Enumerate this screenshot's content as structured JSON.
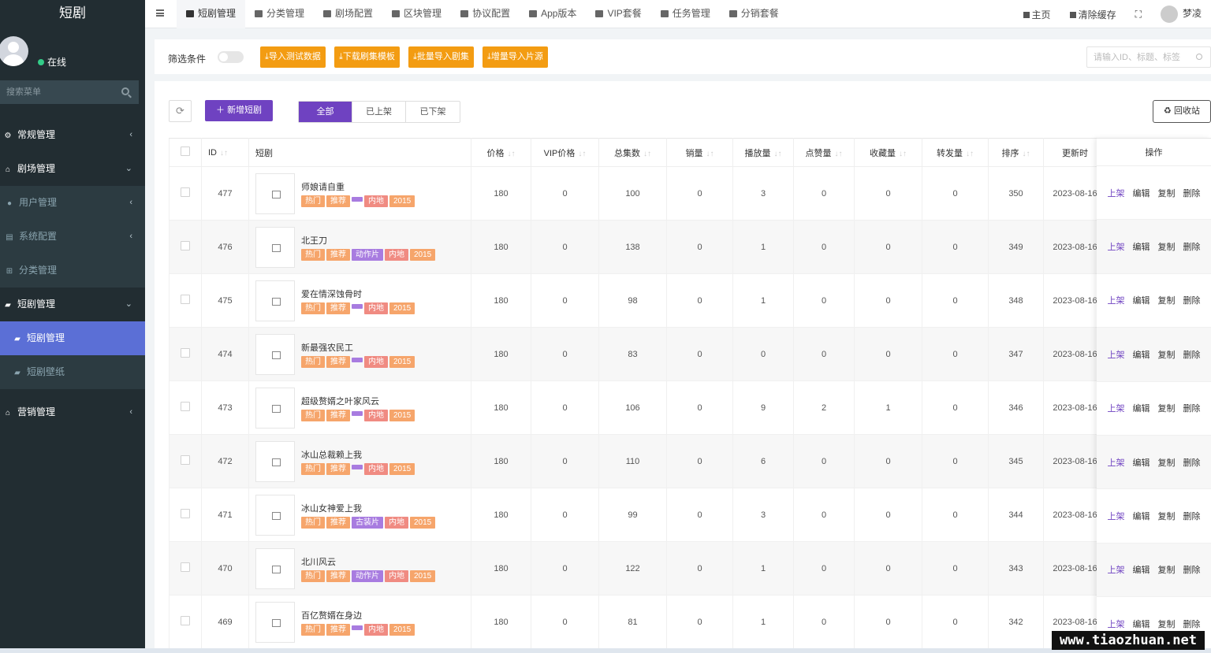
{
  "app": {
    "title": "短剧",
    "user_status": "在线",
    "search_placeholder": "搜索菜单"
  },
  "sidebar": {
    "items": [
      {
        "label": "常规管理",
        "icon": "gears-icon",
        "arrow": "‹"
      },
      {
        "label": "剧场管理",
        "icon": "home-icon",
        "arrow": "⌄"
      },
      {
        "label": "用户管理",
        "icon": "user-icon",
        "arrow": "‹"
      },
      {
        "label": "系统配置",
        "icon": "file-icon",
        "arrow": "‹"
      },
      {
        "label": "分类管理",
        "icon": "sitemap-icon",
        "arrow": ""
      },
      {
        "label": "短剧管理",
        "icon": "bag-icon",
        "arrow": "⌄"
      },
      {
        "label": "短剧管理",
        "icon": "bag-icon",
        "arrow": ""
      },
      {
        "label": "短剧壁纸",
        "icon": "bag-icon",
        "arrow": ""
      },
      {
        "label": "营销管理",
        "icon": "home-icon",
        "arrow": "‹"
      }
    ]
  },
  "topbar": {
    "tabs": [
      "短剧管理",
      "分类管理",
      "剧场配置",
      "区块管理",
      "协议配置",
      "App版本",
      "VIP套餐",
      "任务管理",
      "分销套餐"
    ],
    "home": "主页",
    "clear_cache": "清除缓存",
    "username": "梦凌"
  },
  "filter": {
    "label": "筛选条件",
    "buttons": [
      "⤓导入测试数据",
      "⤓下载刷集模板",
      "⤓批量导入剧集",
      "⤓增量导入片源"
    ],
    "search_placeholder": "请输入ID、标题、标签"
  },
  "toolbar": {
    "add_label": "新增短剧",
    "segments": [
      "全部",
      "已上架",
      "已下架"
    ],
    "recycle_label": "回收站"
  },
  "table": {
    "headers": [
      "ID",
      "短剧",
      "价格",
      "VIP价格",
      "总集数",
      "销量",
      "播放量",
      "点赞量",
      "收藏量",
      "转发量",
      "排序",
      "更新时",
      "操作"
    ],
    "actions": [
      "上架",
      "编辑",
      "复制",
      "删除"
    ],
    "rows": [
      {
        "id": "477",
        "title": "师娘请自重",
        "tags": [
          "热门",
          "推荐",
          "",
          "内地",
          "2015"
        ],
        "price": "180",
        "vip": "0",
        "episodes": "100",
        "sales": "0",
        "plays": "3",
        "likes": "0",
        "favs": "0",
        "shares": "0",
        "sort": "350",
        "updated": "2023-08-16"
      },
      {
        "id": "476",
        "title": "北王刀",
        "tags": [
          "热门",
          "推荐",
          "动作片",
          "内地",
          "2015"
        ],
        "price": "180",
        "vip": "0",
        "episodes": "138",
        "sales": "0",
        "plays": "1",
        "likes": "0",
        "favs": "0",
        "shares": "0",
        "sort": "349",
        "updated": "2023-08-16"
      },
      {
        "id": "475",
        "title": "爱在情深蚀骨时",
        "tags": [
          "热门",
          "推荐",
          "",
          "内地",
          "2015"
        ],
        "price": "180",
        "vip": "0",
        "episodes": "98",
        "sales": "0",
        "plays": "1",
        "likes": "0",
        "favs": "0",
        "shares": "0",
        "sort": "348",
        "updated": "2023-08-16"
      },
      {
        "id": "474",
        "title": "新最强农民工",
        "tags": [
          "热门",
          "推荐",
          "",
          "内地",
          "2015"
        ],
        "price": "180",
        "vip": "0",
        "episodes": "83",
        "sales": "0",
        "plays": "0",
        "likes": "0",
        "favs": "0",
        "shares": "0",
        "sort": "347",
        "updated": "2023-08-16"
      },
      {
        "id": "473",
        "title": "超级赘婿之叶家风云",
        "tags": [
          "热门",
          "推荐",
          "",
          "内地",
          "2015"
        ],
        "price": "180",
        "vip": "0",
        "episodes": "106",
        "sales": "0",
        "plays": "9",
        "likes": "2",
        "favs": "1",
        "shares": "0",
        "sort": "346",
        "updated": "2023-08-16"
      },
      {
        "id": "472",
        "title": "冰山总裁赖上我",
        "tags": [
          "热门",
          "推荐",
          "",
          "内地",
          "2015"
        ],
        "price": "180",
        "vip": "0",
        "episodes": "110",
        "sales": "0",
        "plays": "6",
        "likes": "0",
        "favs": "0",
        "shares": "0",
        "sort": "345",
        "updated": "2023-08-16"
      },
      {
        "id": "471",
        "title": "冰山女神爱上我",
        "tags": [
          "热门",
          "推荐",
          "古装片",
          "内地",
          "2015"
        ],
        "price": "180",
        "vip": "0",
        "episodes": "99",
        "sales": "0",
        "plays": "3",
        "likes": "0",
        "favs": "0",
        "shares": "0",
        "sort": "344",
        "updated": "2023-08-16"
      },
      {
        "id": "470",
        "title": "北川风云",
        "tags": [
          "热门",
          "推荐",
          "动作片",
          "内地",
          "2015"
        ],
        "price": "180",
        "vip": "0",
        "episodes": "122",
        "sales": "0",
        "plays": "1",
        "likes": "0",
        "favs": "0",
        "shares": "0",
        "sort": "343",
        "updated": "2023-08-16"
      },
      {
        "id": "469",
        "title": "百亿赘婿在身边",
        "tags": [
          "热门",
          "推荐",
          "",
          "内地",
          "2015"
        ],
        "price": "180",
        "vip": "0",
        "episodes": "81",
        "sales": "0",
        "plays": "1",
        "likes": "0",
        "favs": "0",
        "shares": "0",
        "sort": "342",
        "updated": "2023-08-16"
      }
    ]
  },
  "watermark": "www.tiaozhuan.net",
  "colors": {
    "sidebar": "#222d32",
    "accent": "#6f42c1",
    "active_menu": "#5b6fd6",
    "orange": "#f39c12"
  }
}
